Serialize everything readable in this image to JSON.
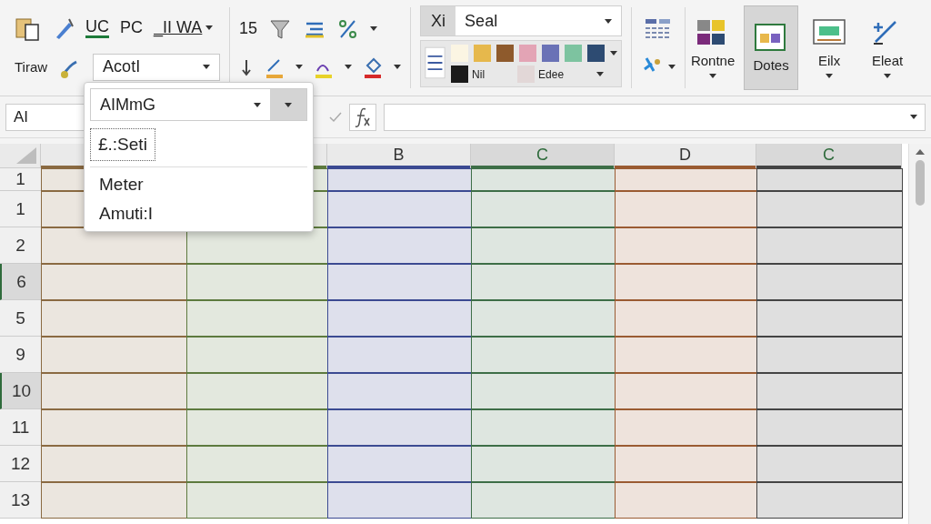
{
  "ribbon": {
    "clipboard_label": "Tiraw",
    "font_buttons": [
      {
        "label": "UC",
        "kind": "underline-green"
      },
      {
        "label": "PC",
        "kind": "plain"
      },
      {
        "label": "_II WA",
        "kind": "menu"
      }
    ],
    "font_size": "15",
    "font_name": "AcotI",
    "styles": {
      "prefix": "Xi",
      "value": "Seal",
      "swatches": [
        {
          "color": "#fbf5e3"
        },
        {
          "color": "#e6b84c"
        },
        {
          "color": "#8e5a2c"
        },
        {
          "color": "#e3a4b5"
        },
        {
          "color": "#6a72b6"
        },
        {
          "color": "#7dc3a0"
        },
        {
          "color": "#2d4b72"
        }
      ],
      "named_swatches": [
        {
          "label": "Nil",
          "color": "#1b1b1b"
        },
        {
          "label": "Edee",
          "color": "#e2d7d7"
        }
      ]
    },
    "commands": [
      {
        "label": "Rontne",
        "selected": false
      },
      {
        "label": "Dotes",
        "selected": true
      },
      {
        "label": "Eilx",
        "selected": false
      },
      {
        "label": "Eleat",
        "selected": false
      }
    ]
  },
  "formula_bar": {
    "name_box": "AI"
  },
  "dropdown": {
    "value": "AIMmG",
    "items": [
      {
        "label": "£.:Seti",
        "selected": true
      },
      {
        "label": "Meter",
        "selected": false
      },
      {
        "label": "Amuti:I",
        "selected": false
      }
    ]
  },
  "sheet": {
    "columns": [
      {
        "color": "#8a6a42",
        "selected": false
      },
      {
        "color": "#5d7a3e",
        "selected": false
      },
      {
        "label": "B",
        "color": "#3b4a92",
        "selected": false
      },
      {
        "label": "C",
        "color": "#3d6e47",
        "selected": true
      },
      {
        "label": "D",
        "color": "#9a5b32",
        "selected": false
      },
      {
        "label": "C",
        "color": "#444444",
        "selected": true
      }
    ],
    "rows": [
      {
        "label": "1",
        "selected": false
      },
      {
        "label": "1",
        "selected": false
      },
      {
        "label": "2",
        "selected": false
      },
      {
        "label": "6",
        "selected": true
      },
      {
        "label": "5",
        "selected": false
      },
      {
        "label": "9",
        "selected": false
      },
      {
        "label": "10",
        "selected": true
      },
      {
        "label": "11",
        "selected": false
      },
      {
        "label": "12",
        "selected": false
      },
      {
        "label": "13",
        "selected": false
      }
    ]
  }
}
